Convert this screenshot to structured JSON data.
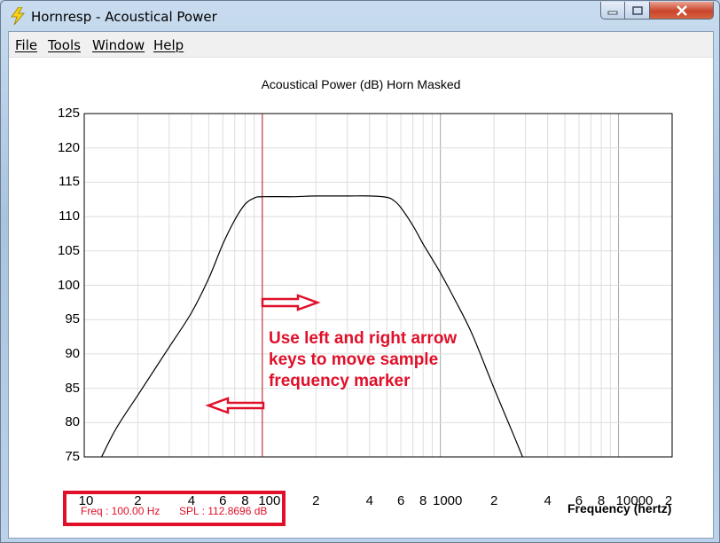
{
  "window": {
    "title": "Hornresp - Acoustical Power"
  },
  "menu": {
    "items": [
      "File",
      "Tools",
      "Window",
      "Help"
    ]
  },
  "chart_data": {
    "type": "line",
    "title": "Acoustical Power (dB)   Horn   Masked",
    "xlabel": "Frequency (hertz)",
    "ylabel": "",
    "x_scale": "log",
    "xlim": [
      10,
      20000
    ],
    "ylim": [
      75,
      125
    ],
    "yticks": [
      125,
      120,
      115,
      110,
      105,
      100,
      95,
      90,
      85,
      80,
      75
    ],
    "xtick_labels": [
      "10",
      "2",
      "4",
      "6",
      "8",
      "100",
      "2",
      "4",
      "6",
      "8",
      "1000",
      "2",
      "4",
      "6",
      "8",
      "10000",
      "2"
    ],
    "grid": true,
    "series": [
      {
        "x": [
          12,
          15,
          20,
          30,
          40,
          50,
          60,
          70,
          80,
          90,
          100,
          150,
          200,
          300,
          400,
          500,
          550,
          600,
          700,
          800,
          900,
          1000,
          1200,
          1500,
          2000,
          2500,
          3000
        ],
        "values": [
          74,
          79,
          84,
          91,
          96,
          101,
          106,
          109.5,
          111.8,
          112.7,
          112.9,
          112.9,
          113,
          113,
          113,
          112.8,
          112.3,
          111.3,
          108.7,
          106,
          103.8,
          101.8,
          98,
          93,
          85,
          79,
          74
        ]
      }
    ],
    "marker_frequency": 100,
    "marker_color": "#c0202a",
    "line_color": "#000000"
  },
  "annotation": {
    "lines": [
      "Use left and right arrow",
      "keys to move sample",
      "frequency marker"
    ],
    "color": "#e0102a"
  },
  "status": {
    "freq": "Freq : 100.00 Hz",
    "spl": "SPL : 112.8696 dB"
  }
}
